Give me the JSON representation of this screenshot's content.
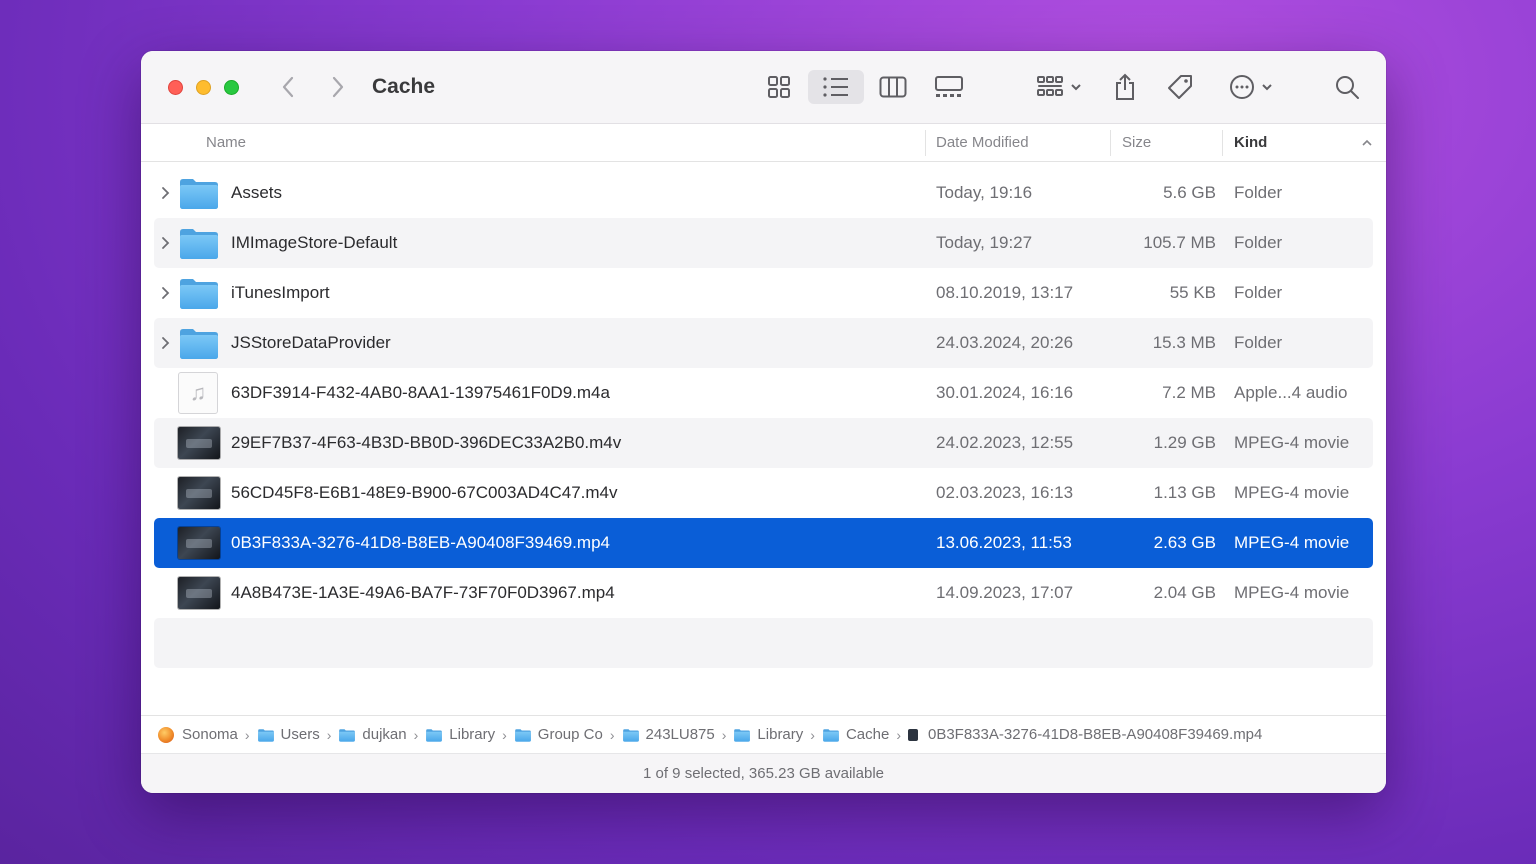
{
  "window": {
    "title": "Cache",
    "traffic_lights": [
      "close",
      "minimize",
      "zoom"
    ]
  },
  "toolbar": {
    "back_icon": "chevron-left-icon",
    "forward_icon": "chevron-right-icon",
    "view_modes": [
      "icon-view",
      "list-view",
      "column-view",
      "gallery-view"
    ],
    "active_view": "list-view",
    "group_icon": "group-icon",
    "share_icon": "share-icon",
    "tag_icon": "tag-icon",
    "more_icon": "ellipsis-circle-icon",
    "search_icon": "search-icon"
  },
  "columns": {
    "name": "Name",
    "date_modified": "Date Modified",
    "size": "Size",
    "kind": "Kind",
    "sort_indicator": "^"
  },
  "files": [
    {
      "name": "Assets",
      "date": "Today, 19:16",
      "size": "5.6 GB",
      "kind": "Folder",
      "icon": "folder-icon"
    },
    {
      "name": "IMImageStore-Default",
      "date": "Today, 19:27",
      "size": "105.7 MB",
      "kind": "Folder",
      "icon": "folder-icon"
    },
    {
      "name": "iTunesImport",
      "date": "08.10.2019, 13:17",
      "size": "55 KB",
      "kind": "Folder",
      "icon": "folder-icon"
    },
    {
      "name": "JSStoreDataProvider",
      "date": "24.03.2024, 20:26",
      "size": "15.3 MB",
      "kind": "Folder",
      "icon": "folder-icon"
    },
    {
      "name": "63DF3914-F432-4AB0-8AA1-13975461F0D9.m4a",
      "date": "30.01.2024, 16:16",
      "size": "7.2 MB",
      "kind": "Apple...4 audio",
      "icon": "audio-file-icon"
    },
    {
      "name": "29EF7B37-4F63-4B3D-BB0D-396DEC33A2B0.m4v",
      "date": "24.02.2023, 12:55",
      "size": "1.29 GB",
      "kind": "MPEG-4 movie",
      "icon": "video-thumbnail"
    },
    {
      "name": "56CD45F8-E6B1-48E9-B900-67C003AD4C47.m4v",
      "date": "02.03.2023, 16:13",
      "size": "1.13 GB",
      "kind": "MPEG-4 movie",
      "icon": "video-thumbnail"
    },
    {
      "name": "0B3F833A-3276-41D8-B8EB-A90408F39469.mp4",
      "date": "13.06.2023, 11:53",
      "size": "2.63 GB",
      "kind": "MPEG-4 movie",
      "icon": "video-thumbnail",
      "selected": true
    },
    {
      "name": "4A8B473E-1A3E-49A6-BA7F-73F70F0D3967.mp4",
      "date": "14.09.2023, 17:07",
      "size": "2.04 GB",
      "kind": "MPEG-4 movie",
      "icon": "video-thumbnail"
    }
  ],
  "path_bar": [
    {
      "label": "Sonoma",
      "icon": "disk-icon"
    },
    {
      "label": "Users",
      "icon": "folder-icon"
    },
    {
      "label": "dujkan",
      "icon": "folder-icon"
    },
    {
      "label": "Library",
      "icon": "folder-icon"
    },
    {
      "label": "Group Co",
      "icon": "folder-icon"
    },
    {
      "label": "243LU875",
      "icon": "folder-icon"
    },
    {
      "label": "Library",
      "icon": "folder-icon"
    },
    {
      "label": "Cache",
      "icon": "folder-icon"
    },
    {
      "label": "0B3F833A-3276-41D8-B8EB-A90408F39469.mp4",
      "icon": "video-file-icon"
    }
  ],
  "status": "1 of 9 selected, 365.23 GB available",
  "colors": {
    "selection": "#0a5ed7",
    "folder": "#5eb6f0",
    "close": "#ff5f57",
    "minimize": "#febc2e",
    "zoom": "#28c840"
  }
}
